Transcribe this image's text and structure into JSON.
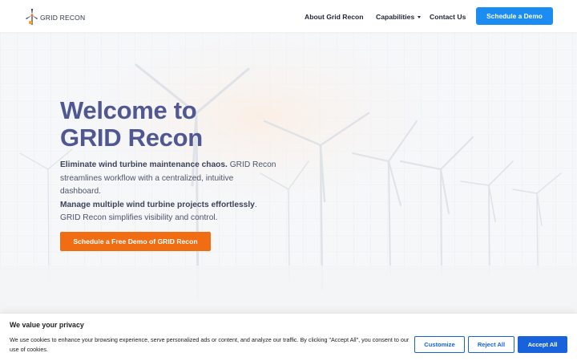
{
  "header": {
    "logo_text": "GRID RECON",
    "nav": {
      "about": "About Grid Recon",
      "capabilities": "Capabilities",
      "contact": "Contact Us"
    },
    "cta": "Schedule a Demo"
  },
  "hero": {
    "title_line1": "Welcome to",
    "title_line2": "GRID Recon",
    "p1_bold": "Eliminate wind turbine maintenance chaos.",
    "p1_rest": " GRID Recon streamlines workflow with a centralized, intuitive dashboard.",
    "p2_bold": "Manage multiple wind turbine projects effortlessly",
    "p2_rest": ". GRID Recon simplifies visibility and control.",
    "cta": "Schedule a Free Demo of GRID Recon"
  },
  "cookie": {
    "title": "We value your privacy",
    "text": "We use cookies to enhance your browsing experience, serve personalized ads or content, and analyze our traffic. By clicking \"Accept All\", you consent to our use of cookies.",
    "customize": "Customize",
    "reject": "Reject All",
    "accept": "Accept All"
  },
  "colors": {
    "primary_blue": "#1b8cf2",
    "orange_cta": "#f06d14",
    "title_purple": "#4f5892",
    "cookie_blue": "#1863dc"
  }
}
